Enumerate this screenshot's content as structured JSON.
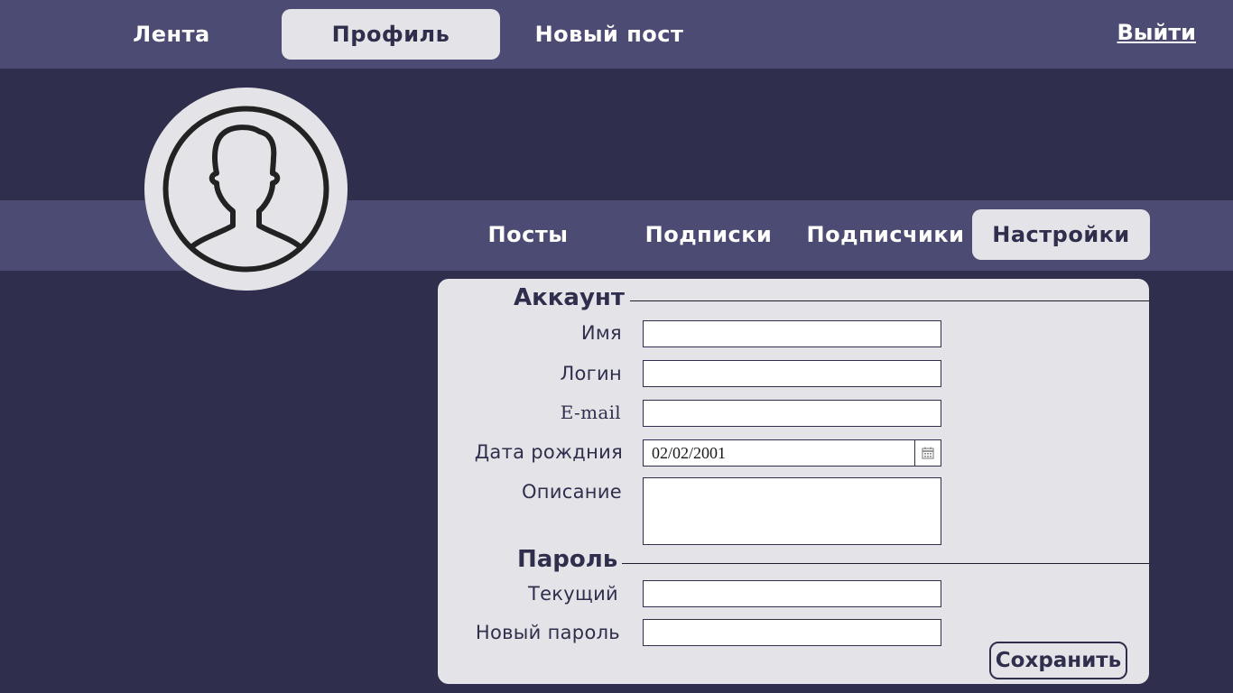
{
  "colors": {
    "background": "#2f2f4d",
    "bar": "#4c4b73",
    "panel": "#e4e4e8",
    "accent_text": "#2f2f4d"
  },
  "topnav": {
    "items": [
      {
        "label": "Лента",
        "active": false
      },
      {
        "label": "Профиль",
        "active": true
      },
      {
        "label": "Новый пост",
        "active": false
      }
    ],
    "logout": "Выйти"
  },
  "avatar": {
    "icon": "user-silhouette-icon"
  },
  "profile_tabs": {
    "items": [
      {
        "label": "Посты",
        "active": false
      },
      {
        "label": "Подписки",
        "active": false
      },
      {
        "label": "Подписчики",
        "active": false
      },
      {
        "label": "Настройки",
        "active": true
      }
    ]
  },
  "settings": {
    "account": {
      "title": "Аккаунт",
      "fields": {
        "name": {
          "label": "Имя",
          "value": ""
        },
        "login": {
          "label": "Логин",
          "value": ""
        },
        "email": {
          "label": "E-mail",
          "value": ""
        },
        "birthdate": {
          "label": "Дата рождния",
          "value": "02/02/2001",
          "icon": "calendar-icon"
        },
        "description": {
          "label": "Описание",
          "value": ""
        }
      }
    },
    "password": {
      "title": "Пароль",
      "fields": {
        "current": {
          "label": "Текущий",
          "value": ""
        },
        "new": {
          "label": "Новый пароль",
          "value": ""
        }
      }
    },
    "save_label": "Сохранить"
  }
}
